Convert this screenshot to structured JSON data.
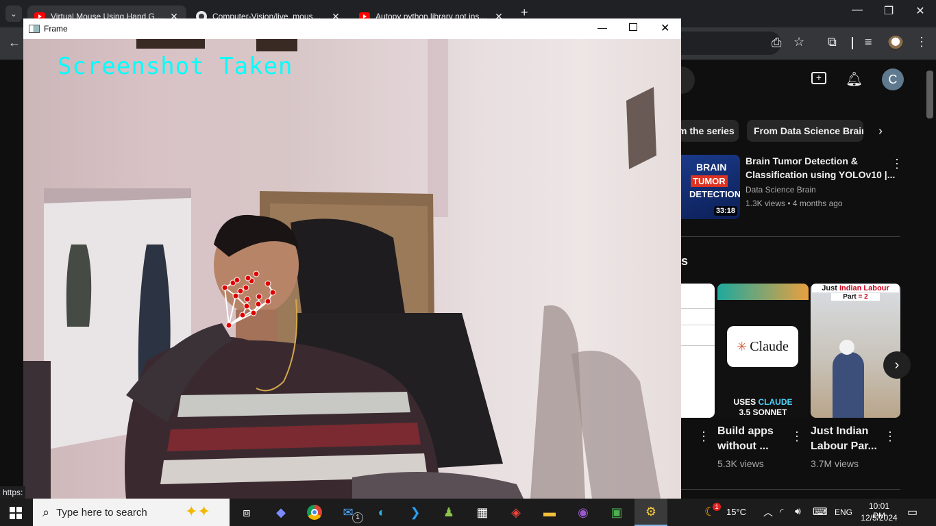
{
  "browser": {
    "tabs": [
      {
        "title": "Virtual Mouse Using Hand Gest",
        "active": true
      },
      {
        "title": "Computer-Vision/live_mouse_c",
        "active": false
      },
      {
        "title": "Autopy python library not instal",
        "active": false
      }
    ],
    "new_tab": "+",
    "status_url": "https:"
  },
  "youtube": {
    "chips": [
      "m the series",
      "From Data Science Brain"
    ],
    "video": {
      "title_line1": "Brain Tumor Detection &",
      "title_line2": "Classification using YOLOv10 |...",
      "channel": "Data Science Brain",
      "meta": "1.3K views • 4 months ago",
      "duration": "33:18",
      "thumb_lines": [
        "BRAIN",
        "TUMOR",
        "DETECTION"
      ]
    },
    "section_letter": "s",
    "shorts": [
      {
        "title_line1": "Build apps",
        "title_line2": "without ...",
        "views": "5.3K views",
        "thumb_brand": "Claude",
        "thumb_caption_1": "USES",
        "thumb_caption_2": "CLAUDE",
        "thumb_caption_3": "3.5 SONNET"
      },
      {
        "title_line1": "Just Indian",
        "title_line2": "Labour Par...",
        "views": "3.7M views",
        "thumb_head_1": "Just",
        "thumb_head_2": "Indian",
        "thumb_head_3": "Labour",
        "thumb_part": "Part",
        "thumb_part_eq": "= 2"
      }
    ],
    "avatar_letter": "C"
  },
  "frame": {
    "title": "Frame",
    "overlay_text": "Screenshot Taken"
  },
  "taskbar": {
    "search_placeholder": "Type here to search",
    "temperature": "15°C",
    "language": "ENG",
    "time": "10:01 PM",
    "date": "12/5/2024",
    "mail_badge": "1",
    "weather_badge": "1"
  },
  "colors": {
    "overlay_text": "#00ffff",
    "landmark": "#e00000",
    "connection": "#ffffff",
    "accent_red": "#ff0000"
  }
}
